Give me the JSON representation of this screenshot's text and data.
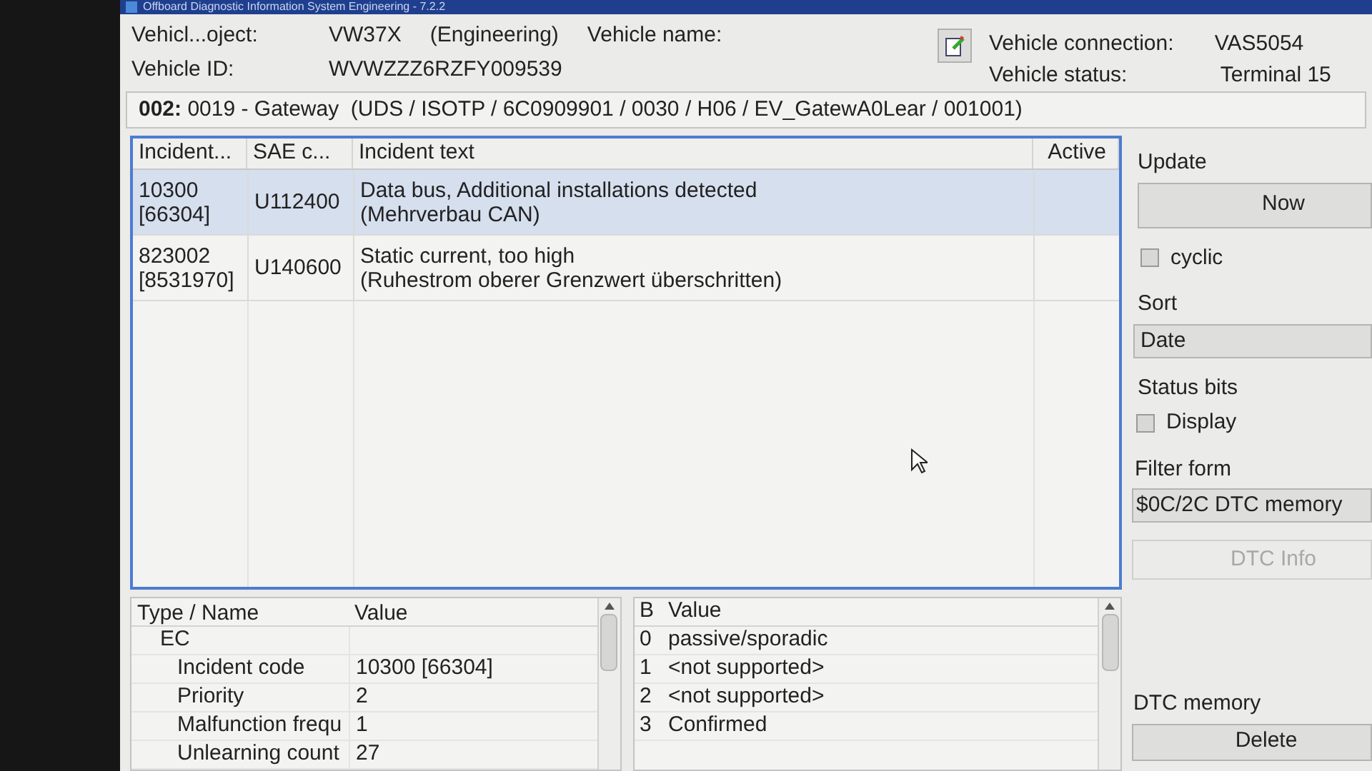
{
  "window": {
    "title": "Offboard Diagnostic Information System Engineering - 7.2.2"
  },
  "vehicle": {
    "project_label": "Vehicl...oject:",
    "project": "VW37X",
    "variant": "(Engineering)",
    "name_label": "Vehicle name:",
    "id_label": "Vehicle ID:",
    "id": "WVWZZZ6RZFY009539",
    "connection_label": "Vehicle connection:",
    "connection": "VAS5054",
    "status_label": "Vehicle status:",
    "status": "Terminal 15"
  },
  "module": {
    "text": "**002:** 0019 - Gateway  (UDS / ISOTP / 6C0909901 / 0030 / H06 / EV_GatewA0Lear / 001001)"
  },
  "incidents": {
    "columns": [
      "Incident...",
      "SAE c...",
      "Incident text",
      "Active"
    ],
    "rows": [
      {
        "code": [
          "10300",
          "[66304]"
        ],
        "sae": "U112400",
        "text": [
          "Data bus, Additional installations detected",
          "(Mehrverbau CAN)"
        ],
        "selected": true
      },
      {
        "code": [
          "823002",
          "[8531970]"
        ],
        "sae": "U140600",
        "text": [
          "Static current, too high",
          "(Ruhestrom oberer Grenzwert überschritten)"
        ],
        "selected": false
      }
    ]
  },
  "details": {
    "columns": [
      "Type / Name",
      "Value"
    ],
    "rows": [
      {
        "name": "EC",
        "children": [
          {
            "name": "Incident code",
            "value": "10300 [66304]"
          },
          {
            "name": "Priority",
            "value": "2"
          },
          {
            "name": "Malfunction frequ",
            "value": "1"
          },
          {
            "name": "Unlearning count",
            "value": "27"
          }
        ]
      }
    ]
  },
  "status_bits": {
    "columns": [
      "B",
      "Value"
    ],
    "rows": [
      {
        "bit": "0",
        "value": "passive/sporadic"
      },
      {
        "bit": "1",
        "value": "<not supported>"
      },
      {
        "bit": "2",
        "value": "<not supported>"
      },
      {
        "bit": "3",
        "value": "Confirmed"
      }
    ]
  },
  "side": {
    "update_label": "Update",
    "now_button": "Now",
    "cyclic": {
      "label": "cyclic",
      "checked": false
    },
    "sort_label": "Sort",
    "sort": "Date",
    "status_bits_label": "Status bits",
    "display": {
      "label": "Display",
      "checked": false
    },
    "filter_label": "Filter form",
    "filter": "$0C/2C DTC memory",
    "dtc_info": {
      "label": "DTC Info",
      "disabled": true
    },
    "memory_label": "DTC memory",
    "delete_button": "Delete"
  }
}
